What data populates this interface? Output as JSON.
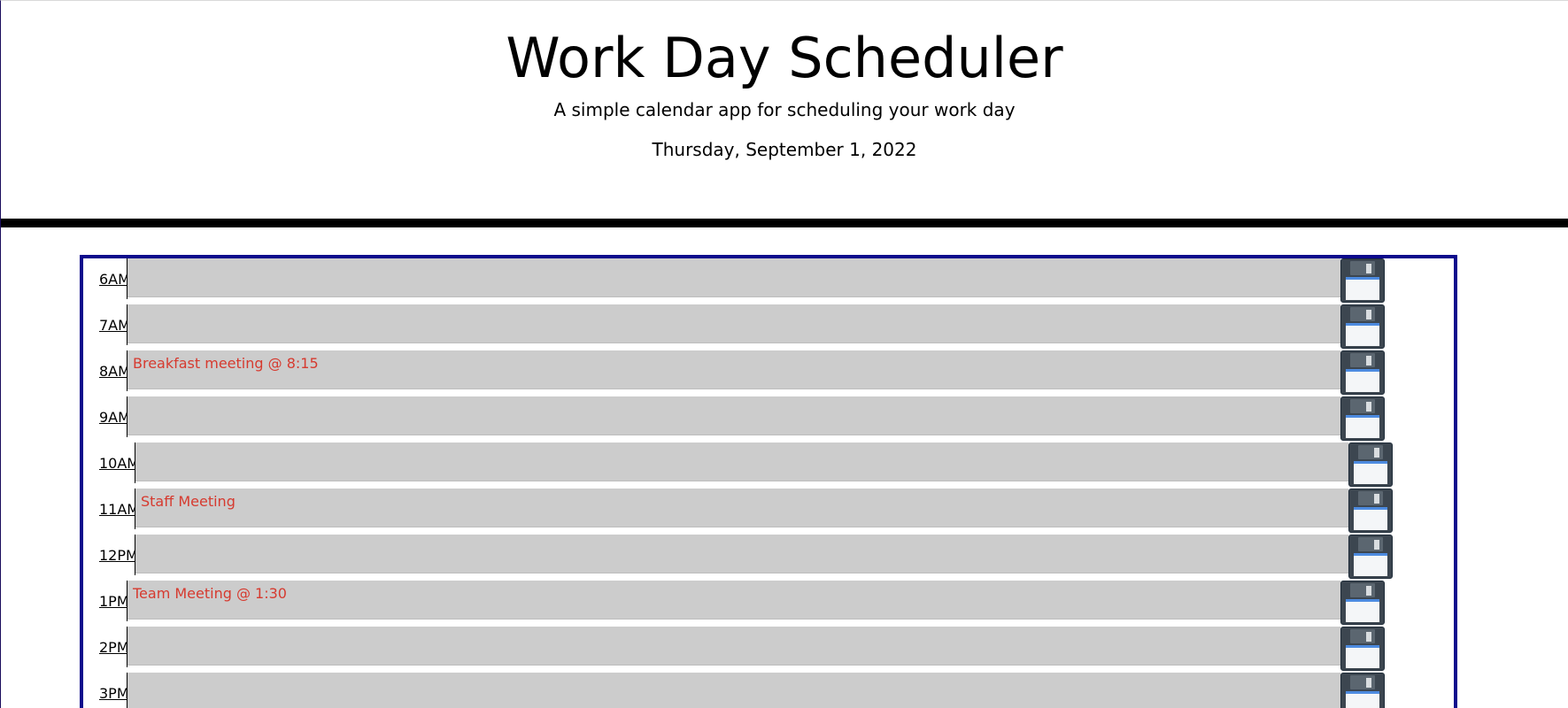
{
  "header": {
    "title": "Work Day Scheduler",
    "subtitle": "A simple calendar app for scheduling your work day",
    "current_day": "Thursday, September 1, 2022"
  },
  "colors": {
    "container_border": "#0d0a8c",
    "slot_background": "#cccccc",
    "entry_text": "#d63a2f",
    "divider": "#000000"
  },
  "icons": {
    "save": "floppy-disk-icon"
  },
  "schedule": [
    {
      "hour": "6AM",
      "entry": ""
    },
    {
      "hour": "7AM",
      "entry": ""
    },
    {
      "hour": "8AM",
      "entry": "Breakfast meeting @ 8:15"
    },
    {
      "hour": "9AM",
      "entry": ""
    },
    {
      "hour": "10AM",
      "entry": ""
    },
    {
      "hour": "11AM",
      "entry": "Staff Meeting"
    },
    {
      "hour": "12PM",
      "entry": ""
    },
    {
      "hour": "1PM",
      "entry": "Team Meeting @ 1:30"
    },
    {
      "hour": "2PM",
      "entry": ""
    },
    {
      "hour": "3PM",
      "entry": ""
    }
  ]
}
